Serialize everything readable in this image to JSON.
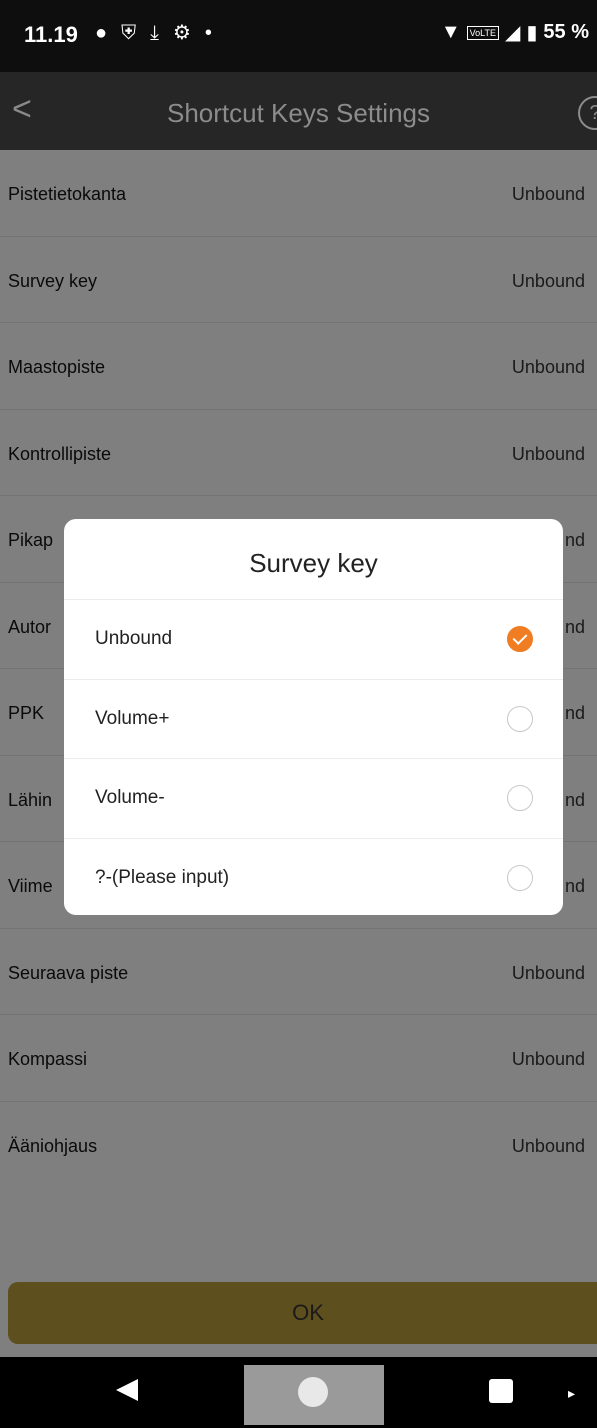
{
  "status_bar": {
    "time": "11.19",
    "left_icons": [
      "chat-icon",
      "shield-icon",
      "download-icon",
      "gear-icon",
      "dot-icon"
    ],
    "right_icons": [
      "wifi-icon",
      "volte-icon",
      "signal-icon",
      "battery-icon"
    ],
    "volte_label": "VoLTE",
    "battery": "55 %"
  },
  "header": {
    "back_glyph": "<",
    "title": "Shortcut Keys Settings",
    "help_glyph": "?"
  },
  "settings": {
    "items": [
      {
        "name": "Pistetietokanta",
        "value": "Unbound"
      },
      {
        "name": "Survey key",
        "value": "Unbound"
      },
      {
        "name": "Maastopiste",
        "value": "Unbound"
      },
      {
        "name": "Kontrollipiste",
        "value": "Unbound"
      },
      {
        "name": "Pikap",
        "value": "nd"
      },
      {
        "name": "Autor",
        "value": "nd"
      },
      {
        "name": "PPK",
        "value": "nd"
      },
      {
        "name": "Lähin",
        "value": "nd"
      },
      {
        "name": "Viime",
        "value": "nd"
      },
      {
        "name": "Seuraava piste",
        "value": "Unbound"
      },
      {
        "name": "Kompassi",
        "value": "Unbound"
      },
      {
        "name": "Ääniohjaus",
        "value": "Unbound"
      }
    ]
  },
  "ok_button": {
    "label": "OK"
  },
  "dialog": {
    "title": "Survey key",
    "options": [
      {
        "label": "Unbound",
        "selected": true
      },
      {
        "label": "Volume+",
        "selected": false
      },
      {
        "label": "Volume-",
        "selected": false
      },
      {
        "label": "?-(Please input)",
        "selected": false
      }
    ]
  },
  "colors": {
    "accent": "#f07d22",
    "ok_button_bg": "#5e4f1e",
    "header_bg": "#262626",
    "overlay_bg": "#7f7f7f"
  }
}
